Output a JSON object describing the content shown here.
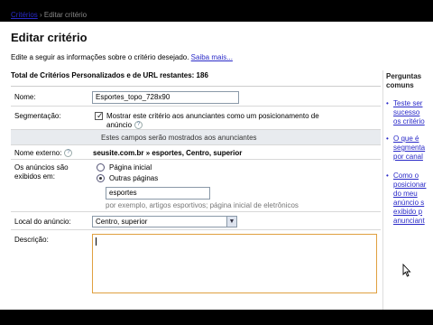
{
  "breadcrumb": {
    "link": "Critérios",
    "separator": "›",
    "current": "Editar critério"
  },
  "page": {
    "title": "Editar critério",
    "intro": "Edite a seguir as informações sobre o critério desejado.",
    "more_link": "Saiba mais...",
    "remaining": "Total de Critérios Personalizados e de URL restantes: 186"
  },
  "form": {
    "name_label": "Nome:",
    "name_value": "Esportes_topo_728x90",
    "segmentation_label": "Segmentação:",
    "segmentation_text_1": "Mostrar este critério aos anunciantes como um posicionamento de",
    "segmentation_text_2": "anúncio",
    "section_note": "Estes campos serão mostrados aos anunciantes",
    "external_label": "Nome externo:",
    "external_value": "seusite.com.br » esportes, Centro, superior",
    "shown_label_1": "Os anúncios são",
    "shown_label_2": "exibidos em:",
    "radio_home": "Página inicial",
    "radio_other": "Outras páginas",
    "other_value": "esportes",
    "other_hint": "por exemplo, artigos esportivos; página inicial de eletrônicos",
    "location_label": "Local do anúncio:",
    "location_value": "Centro, superior",
    "description_label": "Descrição:"
  },
  "sidebar": {
    "title_1": "Perguntas",
    "title_2": "comuns",
    "items": [
      {
        "lines": [
          "Teste ser",
          "sucesso",
          "os critério"
        ]
      },
      {
        "lines": [
          "O que é",
          "segmenta",
          "por canal"
        ]
      },
      {
        "lines": [
          "Como o",
          "posicionar",
          "do meu",
          "anúncio s",
          "exibido p",
          "anunciant"
        ]
      }
    ]
  },
  "colors": {
    "link": "#2a2ac8",
    "section_bg": "#e8ebef",
    "textarea_border": "#e0a040"
  }
}
